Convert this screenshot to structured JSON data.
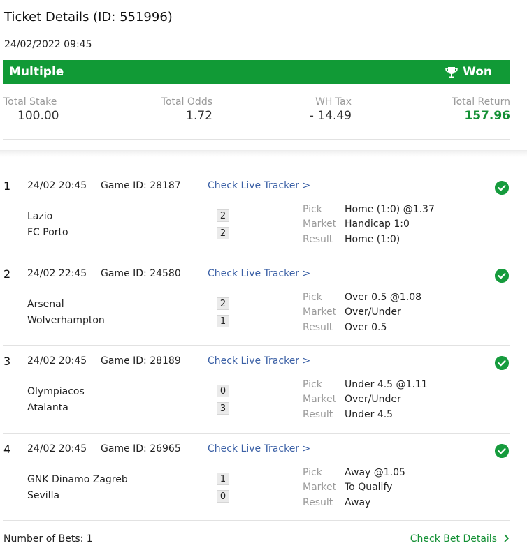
{
  "ticket": {
    "title": "Ticket Details (ID: 551996)",
    "datetime": "24/02/2022 09:45",
    "type": "Multiple",
    "status": "Won"
  },
  "totals": {
    "stake_label": "Total Stake",
    "stake_value": "100.00",
    "odds_label": "Total Odds",
    "odds_value": "1.72",
    "tax_label": "WH Tax",
    "tax_value": "- 14.49",
    "return_label": "Total Return",
    "return_value": "157.96"
  },
  "labels": {
    "pick": "Pick",
    "market": "Market",
    "result": "Result",
    "tracker": "Check Live Tracker >"
  },
  "bets": [
    {
      "num": "1",
      "time": "24/02 20:45",
      "game_id": "Game ID: 28187",
      "team1": "Lazio",
      "team2": "FC Porto",
      "score1": "2",
      "score2": "2",
      "pick": "Home (1:0) @1.37",
      "market": "Handicap 1:0",
      "result": "Home (1:0)"
    },
    {
      "num": "2",
      "time": "24/02 22:45",
      "game_id": "Game ID: 24580",
      "team1": "Arsenal",
      "team2": "Wolverhampton",
      "score1": "2",
      "score2": "1",
      "pick": "Over 0.5 @1.08",
      "market": "Over/Under",
      "result": "Over 0.5"
    },
    {
      "num": "3",
      "time": "24/02 20:45",
      "game_id": "Game ID: 28189",
      "team1": "Olympiacos",
      "team2": "Atalanta",
      "score1": "0",
      "score2": "3",
      "pick": "Under 4.5 @1.11",
      "market": "Over/Under",
      "result": "Under 4.5"
    },
    {
      "num": "4",
      "time": "24/02 20:45",
      "game_id": "Game ID: 26965",
      "team1": "GNK Dinamo Zagreb",
      "team2": "Sevilla",
      "score1": "1",
      "score2": "0",
      "pick": "Away @1.05",
      "market": "To Qualify",
      "result": "Away"
    }
  ],
  "footer": {
    "number_of_bets": "Number of Bets: 1",
    "check_bet_details": "Check Bet Details"
  },
  "colors": {
    "brand_green": "#119a36",
    "won_text": "#149035",
    "link_blue": "#3c61a6"
  },
  "icons": {
    "status": "trophy-icon",
    "bet_result": "check-circle-icon",
    "footer_link": "chevron-right-icon"
  }
}
